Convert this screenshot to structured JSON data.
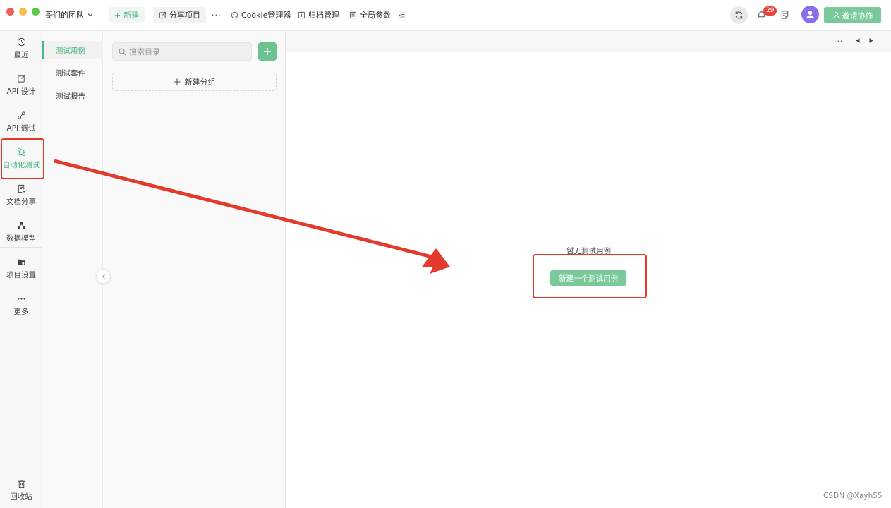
{
  "header": {
    "team_name": "哥们的团队",
    "new_label": "新建",
    "share_label": "分享项目",
    "more_label": "···",
    "cookie_label": "Cookie管理器",
    "archive_label": "归档管理",
    "global_label": "全局参数",
    "notification_count": "29",
    "invite_label": "邀请协作"
  },
  "leftnav": {
    "items": [
      {
        "label": "最近",
        "icon": "clock-icon"
      },
      {
        "label": "API 设计",
        "icon": "edit-icon"
      },
      {
        "label": "API 调试",
        "icon": "debug-icon"
      },
      {
        "label": "自动化测试",
        "icon": "automation-icon"
      },
      {
        "label": "文档分享",
        "icon": "document-icon"
      },
      {
        "label": "数据模型",
        "icon": "model-icon"
      },
      {
        "label": "项目设置",
        "icon": "folder-settings-icon"
      },
      {
        "label": "更多",
        "icon": "more-icon"
      }
    ],
    "trash_label": "回收站"
  },
  "subnav": {
    "items": [
      "测试用例",
      "测试套件",
      "测试报告"
    ]
  },
  "tree": {
    "search_placeholder": "搜索目录",
    "new_group_label": "新建分组"
  },
  "main": {
    "toolbar_more": "···",
    "empty_text": "暂无测试用例",
    "create_label": "新建一个测试用例",
    "watermark": "CSDN @Xayh55"
  },
  "colors": {
    "accent": "#4cb87f",
    "button_green": "#79c99b",
    "annotation_red": "#e23b2e",
    "badge_red": "#e8423a",
    "avatar_purple": "#8a6ee8"
  }
}
